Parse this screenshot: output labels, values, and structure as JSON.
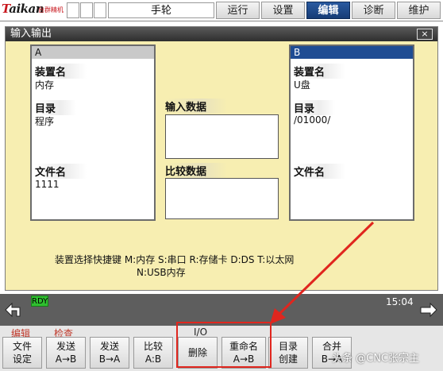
{
  "topbar": {
    "logo_text_a": "T",
    "logo_text_b": "aikan",
    "logo_sub": "台群精机",
    "mode_label": "手轮",
    "tabs": [
      {
        "label": "运行",
        "active": false
      },
      {
        "label": "设置",
        "active": false
      },
      {
        "label": "编辑",
        "active": true
      },
      {
        "label": "诊断",
        "active": false
      },
      {
        "label": "维护",
        "active": false
      }
    ]
  },
  "dialog": {
    "title": "输入输出",
    "close_label": "×",
    "side_a": {
      "header": "A",
      "device_label": "装置名",
      "device_value": "内存",
      "dir_label": "目录",
      "dir_value": "程序",
      "file_label": "文件名",
      "file_value": "1111"
    },
    "side_b": {
      "header": "B",
      "device_label": "装置名",
      "device_value": "U盘",
      "dir_label": "目录",
      "dir_value": "/01000/",
      "file_label": "文件名",
      "file_value": ""
    },
    "input_data_label": "输入数据",
    "compare_data_label": "比较数据",
    "hint_line1": "装置选择快捷键 M:内存 S:串口 R:存储卡 D:DS T:以太网",
    "hint_line2": "N:USB内存"
  },
  "status": {
    "rdy": "RDY",
    "time": "15:04"
  },
  "softkeys": {
    "header_left1": "编辑",
    "header_left2": "检查",
    "header_io": "I/O",
    "keys": [
      {
        "l1": "文件",
        "l2": "设定"
      },
      {
        "l1": "发送",
        "l2": "A→B"
      },
      {
        "l1": "发送",
        "l2": "B→A"
      },
      {
        "l1": "比较",
        "l2": "A:B"
      },
      {
        "l1": "删除",
        "l2": ""
      },
      {
        "l1": "重命名",
        "l2": "A→B"
      },
      {
        "l1": "目录",
        "l2": "创建"
      },
      {
        "l1": "合并",
        "l2": "B→A"
      }
    ]
  },
  "watermark": "头条 @CNC张宗主",
  "colors": {
    "panel_bg": "#f7eeb1",
    "active_tab": "#1f4c93",
    "annotation_red": "#e0261e",
    "rdy_green": "#2fbf2f"
  }
}
